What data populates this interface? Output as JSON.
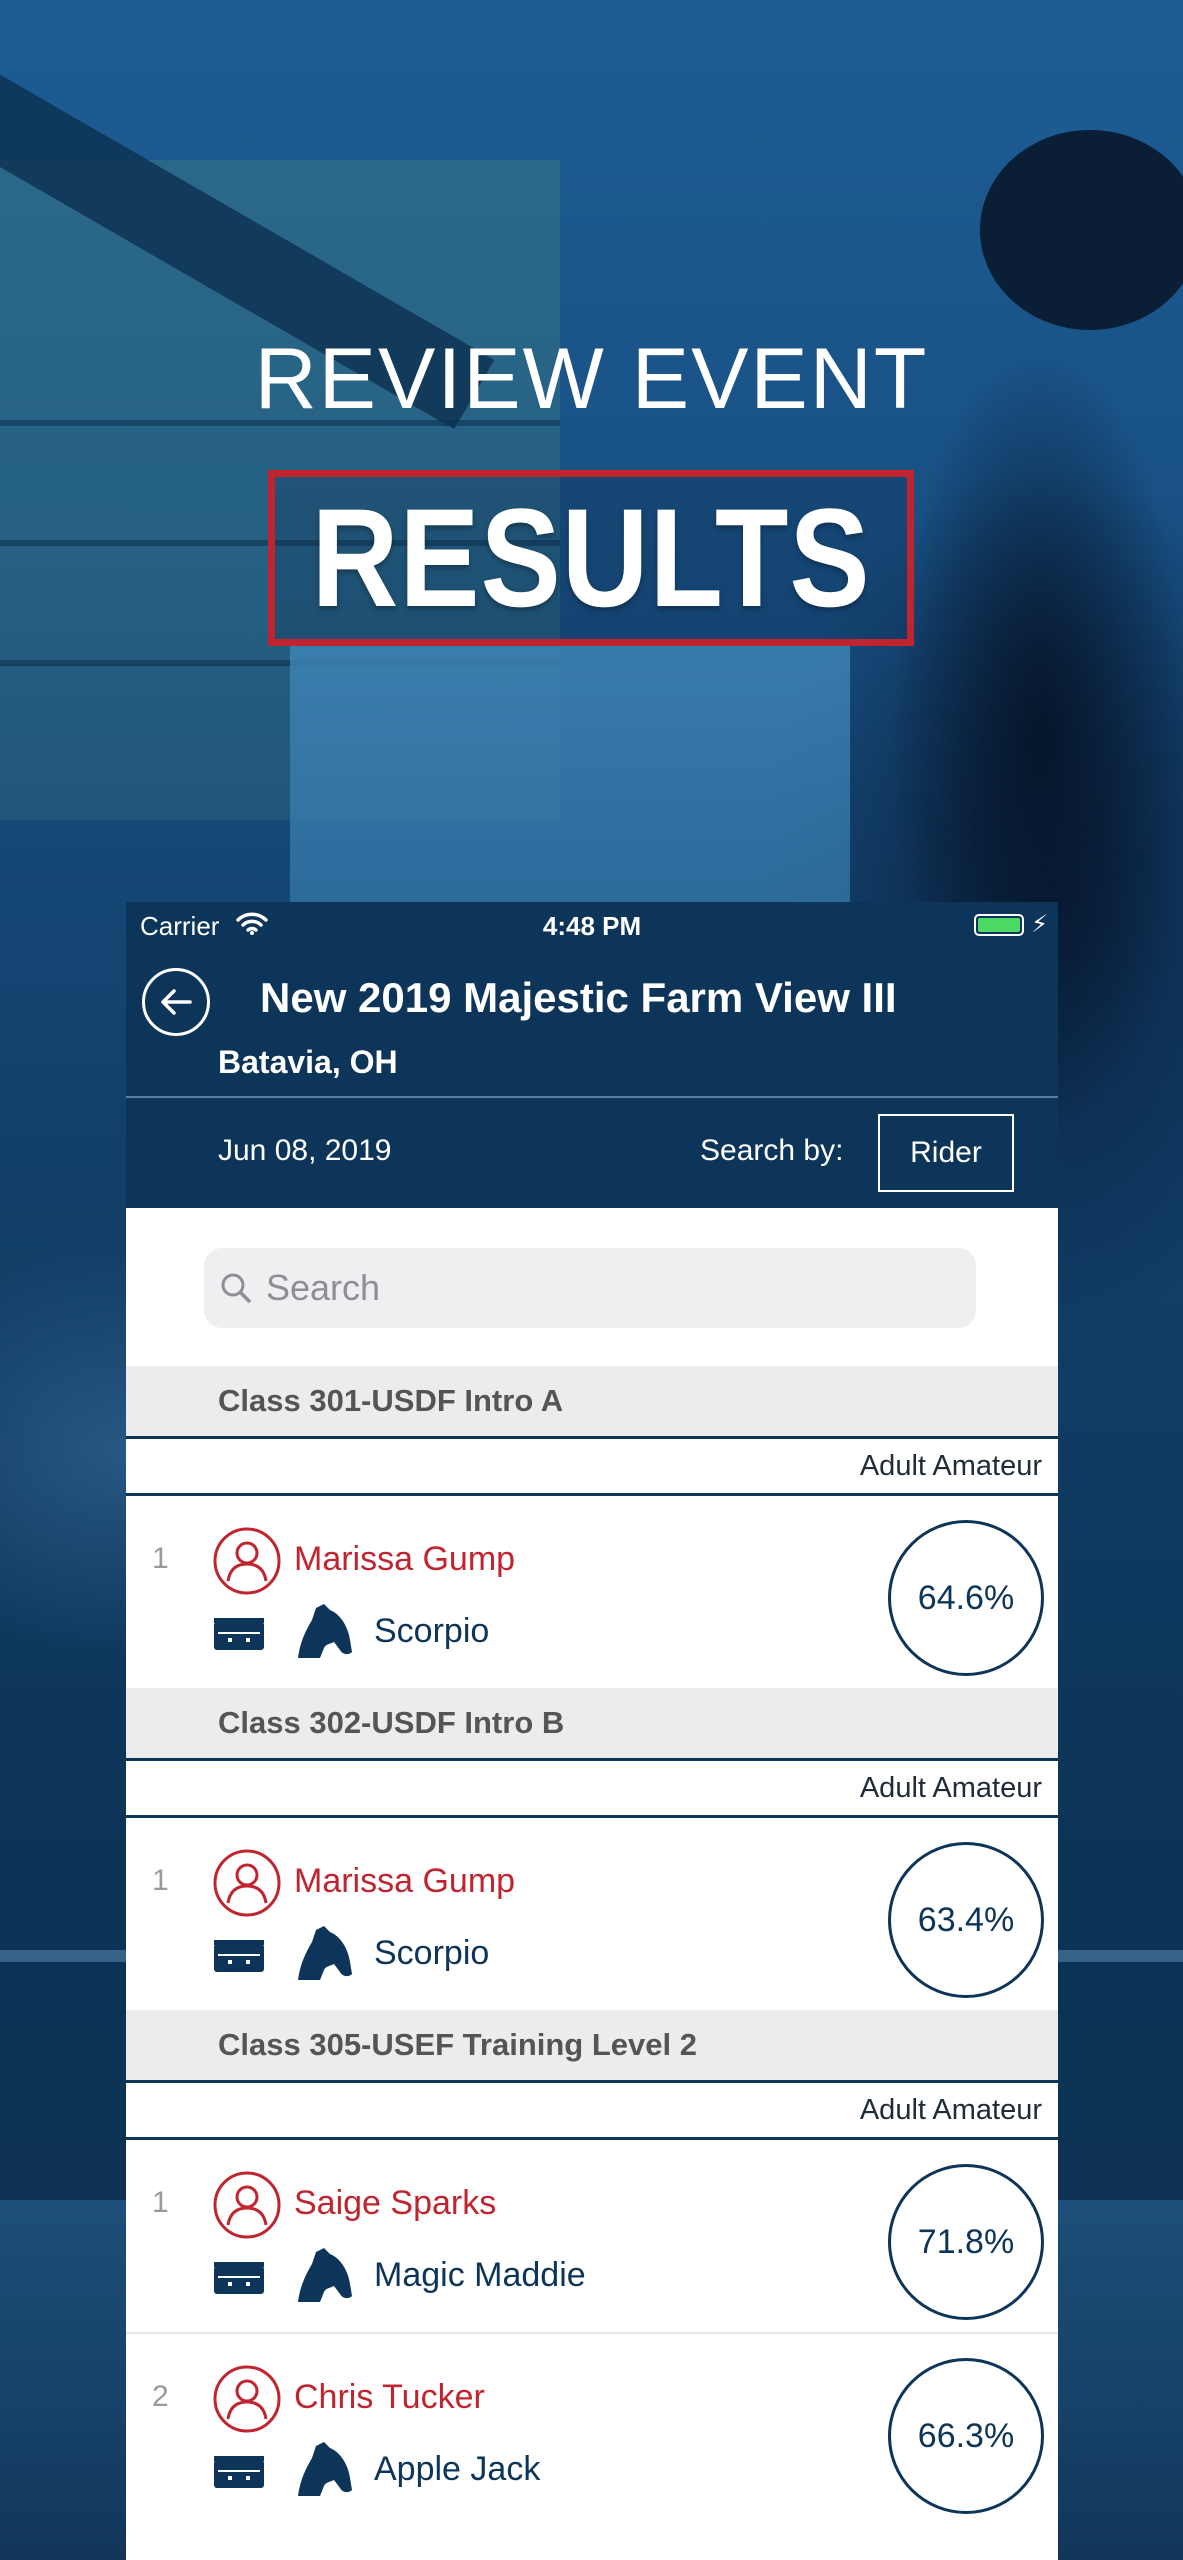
{
  "hero": {
    "subtitle": "REVIEW EVENT",
    "title": "RESULTS"
  },
  "status_bar": {
    "carrier": "Carrier",
    "time": "4:48 PM"
  },
  "nav": {
    "title": "New 2019 Majestic Farm View III",
    "subtitle": "Batavia, OH"
  },
  "filter": {
    "date": "Jun 08, 2019",
    "search_by_label": "Search by:",
    "search_by_value": "Rider"
  },
  "search": {
    "placeholder": "Search"
  },
  "classes": [
    {
      "name": "Class 301-USDF Intro A",
      "group": "Adult Amateur",
      "entries": [
        {
          "rank": "1",
          "rider": "Marissa Gump",
          "horse": "Scorpio",
          "score": "64.6%"
        }
      ]
    },
    {
      "name": "Class 302-USDF Intro B",
      "group": "Adult Amateur",
      "entries": [
        {
          "rank": "1",
          "rider": "Marissa Gump",
          "horse": "Scorpio",
          "score": "63.4%"
        }
      ]
    },
    {
      "name": "Class 305-USEF Training Level 2",
      "group": "Adult Amateur",
      "entries": [
        {
          "rank": "1",
          "rider": "Saige Sparks",
          "horse": "Magic Maddie",
          "score": "71.8%"
        },
        {
          "rank": "2",
          "rider": "Chris Tucker",
          "horse": "Apple Jack",
          "score": "66.3%"
        }
      ]
    }
  ],
  "colors": {
    "navy": "#0d3559",
    "accent_red": "#c0252f",
    "battery_green": "#4cd964"
  },
  "icons": [
    "back-arrow-icon",
    "wifi-icon",
    "battery-icon",
    "search-icon",
    "rider-icon",
    "trailer-icon",
    "horse-icon"
  ]
}
